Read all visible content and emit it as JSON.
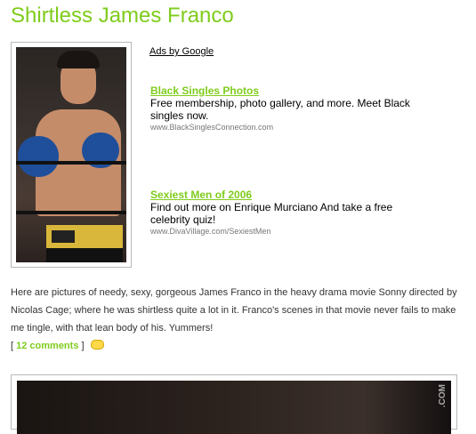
{
  "page": {
    "title": "Shirtless James Franco"
  },
  "ads": {
    "label": "Ads by Google",
    "items": [
      {
        "title": "Black Singles Photos",
        "description": "Free membership, photo gallery, and more. Meet Black singles now.",
        "url": "www.BlackSinglesConnection.com"
      },
      {
        "title": "Sexiest Men of 2006",
        "description": "Find out more on Enrique Murciano And take a free celebrity quiz!",
        "url": "www.DivaVillage.com/SexiestMen"
      }
    ]
  },
  "post": {
    "body": "Here are pictures of needy, sexy, gorgeous James Franco in the heavy drama movie Sonny directed by Nicolas Cage; where he was shirtless quite a lot in it. Franco's scenes in that movie never fails to make me tingle, with that lean body of his. Yummers!",
    "comments_open": "[",
    "comments_link": "12 comments",
    "comments_close": "]"
  },
  "photo2": {
    "watermark": ".COM"
  }
}
